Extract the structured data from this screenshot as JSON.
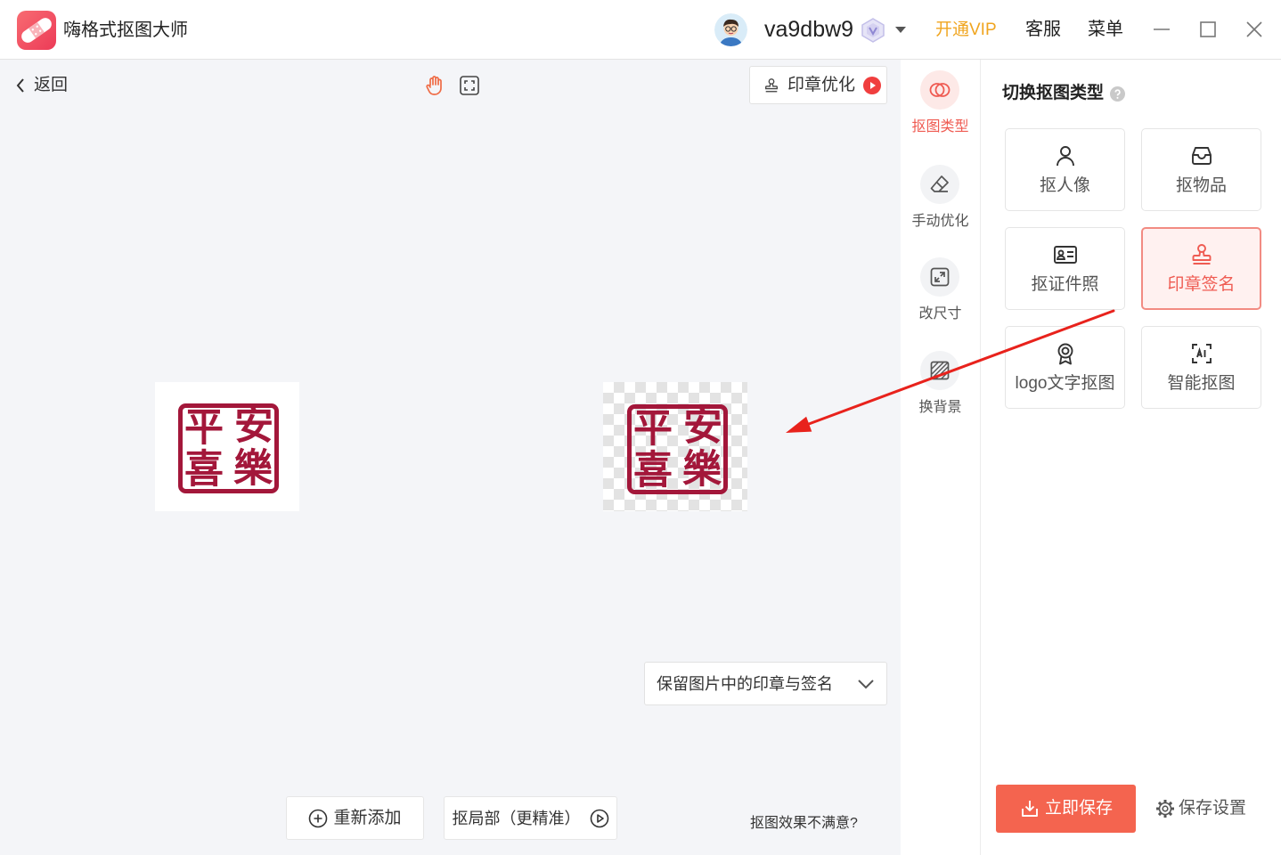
{
  "app": {
    "title": "嗨格式抠图大师",
    "logo_icon": "app-logo-icon"
  },
  "header": {
    "username": "va9dbw9",
    "vip_label": "开通VIP",
    "service_label": "客服",
    "menu_label": "菜单",
    "window_controls": [
      "minimize-icon",
      "maximize-icon",
      "close-icon"
    ]
  },
  "toolbar": {
    "back_label": "返回",
    "stamp_optimize_label": "印章优化"
  },
  "images": {
    "stamp_rows": [
      [
        "平",
        "安"
      ],
      [
        "喜",
        "樂"
      ]
    ]
  },
  "options": {
    "keep_select_value": "保留图片中的印章与签名"
  },
  "actions": {
    "re_add_label": "重新添加",
    "local_cutout_label": "抠局部（更精准）",
    "unsatisfied_label": "抠图效果不满意?"
  },
  "side_nav": {
    "items": [
      {
        "label": "抠图类型",
        "icon": "cutout-type-icon",
        "active": true
      },
      {
        "label": "手动优化",
        "icon": "eraser-icon",
        "active": false
      },
      {
        "label": "改尺寸",
        "icon": "resize-icon",
        "active": false
      },
      {
        "label": "换背景",
        "icon": "change-background-icon",
        "active": false
      }
    ]
  },
  "panel": {
    "title": "切换抠图类型",
    "types": [
      {
        "label": "抠人像",
        "icon": "person-icon",
        "selected": false
      },
      {
        "label": "抠物品",
        "icon": "item-box-icon",
        "selected": false
      },
      {
        "label": "抠证件照",
        "icon": "id-card-icon",
        "selected": false
      },
      {
        "label": "印章签名",
        "icon": "stamp-icon",
        "selected": true
      },
      {
        "label": "logo文字抠图",
        "icon": "logo-badge-icon",
        "selected": false
      },
      {
        "label": "智能抠图",
        "icon": "ai-scan-icon",
        "selected": false
      }
    ],
    "save_label": "立即保存",
    "save_settings_label": "保存设置"
  },
  "colors": {
    "accent": "#f4644f",
    "vip": "#f0a51f",
    "stamp": "#a3173a",
    "active_text": "#ef5b52",
    "annotation": "#e8221c"
  }
}
